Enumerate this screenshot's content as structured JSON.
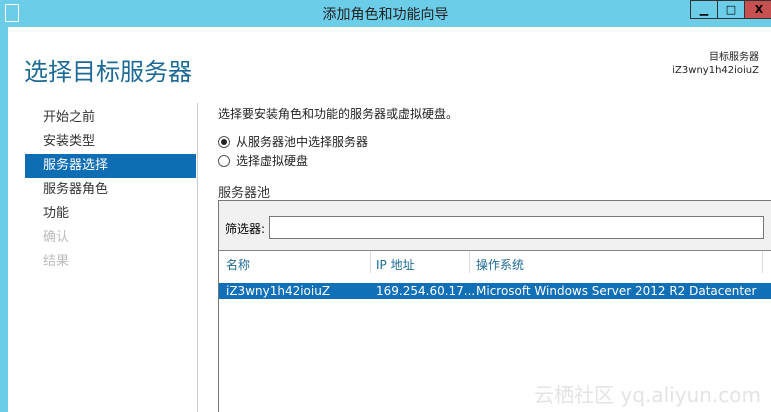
{
  "window": {
    "title": "添加角色和功能向导",
    "minimize": "▁",
    "maximize": "□",
    "close": "X"
  },
  "page": {
    "title": "选择目标服务器",
    "dest_label": "目标服务器",
    "dest_server": "iZ3wny1h42ioiuZ"
  },
  "nav": {
    "items": [
      {
        "label": "开始之前"
      },
      {
        "label": "安装类型"
      },
      {
        "label": "服务器选择"
      },
      {
        "label": "服务器角色"
      },
      {
        "label": "功能"
      },
      {
        "label": "确认"
      },
      {
        "label": "结果"
      }
    ]
  },
  "main": {
    "description": "选择要安装角色和功能的服务器或虚拟硬盘。",
    "radio_pool": "从服务器池中选择服务器",
    "radio_vhd": "选择虚拟硬盘"
  },
  "pool": {
    "title": "服务器池",
    "filter_label": "筛选器:",
    "filter_value": "",
    "columns": [
      "名称",
      "IP 地址",
      "操作系统"
    ],
    "rows": [
      {
        "name": "iZ3wny1h42ioiuZ",
        "ip": "169.254.60.17...",
        "os": "Microsoft Windows Server 2012 R2 Datacenter"
      }
    ]
  },
  "watermark": "云栖社区 yq.aliyun.com"
}
